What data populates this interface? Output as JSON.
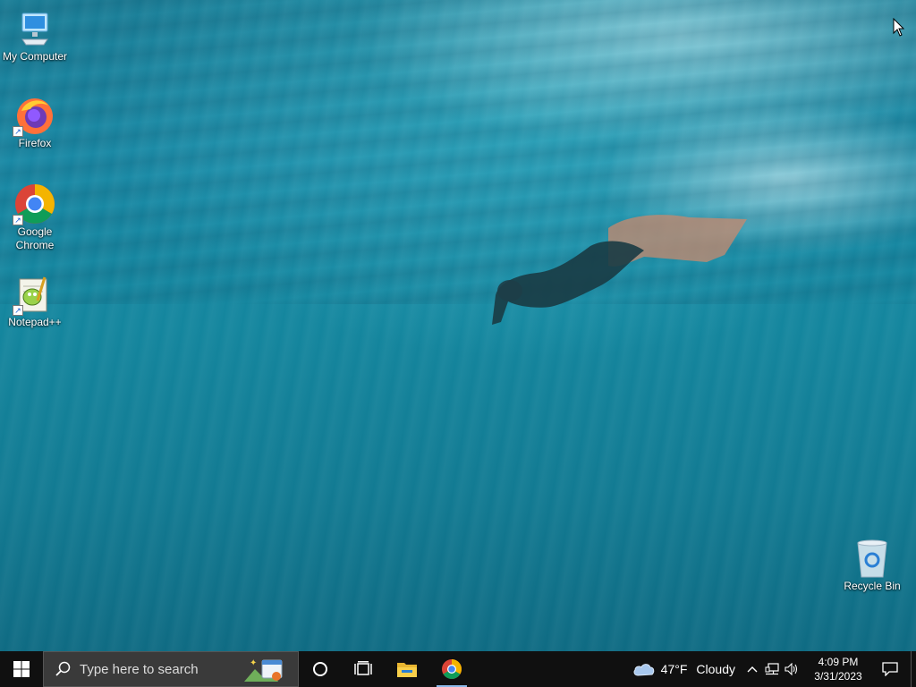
{
  "desktop": {
    "icons": [
      {
        "label": "My Computer",
        "icon": "computer-icon"
      },
      {
        "label": "Firefox",
        "icon": "firefox-icon"
      },
      {
        "label": "Google\nChrome",
        "icon": "chrome-icon"
      },
      {
        "label": "Notepad++",
        "icon": "notepad-plus-plus-icon"
      },
      {
        "label": "Recycle Bin",
        "icon": "recycle-bin-icon"
      }
    ]
  },
  "taskbar": {
    "search_placeholder": "Type here to search",
    "weather": {
      "temp": "47°F",
      "condition": "Cloudy",
      "icon": "cloud-icon"
    },
    "clock": {
      "time": "4:09 PM",
      "date": "3/31/2023"
    },
    "pinned": [
      {
        "name": "File Explorer",
        "icon": "folder-icon"
      },
      {
        "name": "Google Chrome",
        "icon": "chrome-icon",
        "active": true
      }
    ]
  },
  "colors": {
    "taskbar": "#101010",
    "search_box": "#3a3a3a",
    "water": "#1a8aa6",
    "active_underline": "#8bb8e8"
  }
}
